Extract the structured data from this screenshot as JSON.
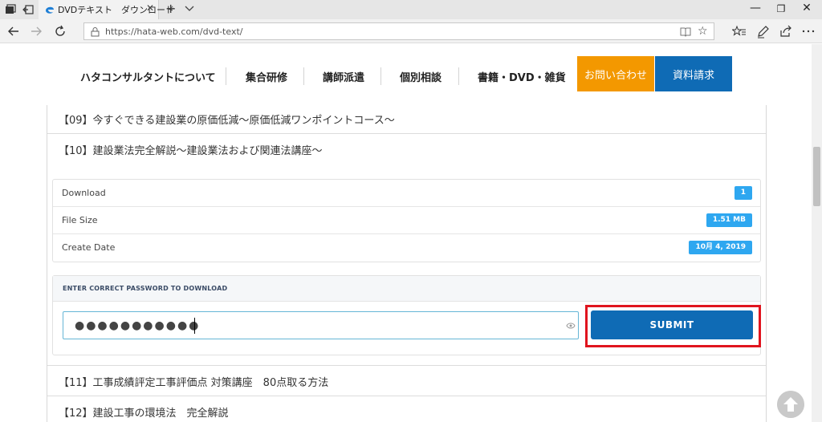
{
  "browser": {
    "tab_title": "DVDテキスト　ダウンロード",
    "url": "https://hata-web.com/dvd-text/"
  },
  "site_nav": {
    "items": [
      "ハタコンサルタントについて",
      "集合研修",
      "講師派遣",
      "個別相談",
      "書籍・DVD・雑貨"
    ],
    "contact_label": "お問い合わせ",
    "request_label": "資料請求",
    "colors": {
      "contact": "#f39800",
      "request": "#0f6bb5"
    }
  },
  "accordion": {
    "items": [
      "【09】今すぐできる建設業の原価低減～原価低減ワンポイントコース～",
      "【10】建設業法完全解説～建設業法および関連法講座～",
      "【11】工事成績評定工事評価点 対策講座　80点取る方法",
      "【12】建設工事の環境法　完全解説"
    ]
  },
  "download": {
    "rows": [
      {
        "label": "Download",
        "value": "1"
      },
      {
        "label": "File Size",
        "value": "1.51 MB"
      },
      {
        "label": "Create Date",
        "value": "10月 4, 2019"
      }
    ],
    "password_heading": "ENTER CORRECT PASSWORD TO DOWNLOAD",
    "password_value": "●●●●●●●●●●●",
    "submit_label": "SUBMIT",
    "badge_color": "#2ea7f0",
    "highlight_color": "#e0141e"
  },
  "icons": [
    "tab-actions-icon",
    "set-aside-icon",
    "edge-favicon",
    "close-icon",
    "new-tab-icon",
    "chevron-down-icon",
    "minimize-icon",
    "maximize-icon",
    "window-close-icon",
    "back-icon",
    "forward-icon",
    "refresh-icon",
    "lock-icon",
    "reading-view-icon",
    "favorite-star-icon",
    "favorites-icon",
    "pen-icon",
    "share-icon",
    "more-icon",
    "eye-icon",
    "back-to-top-icon"
  ]
}
